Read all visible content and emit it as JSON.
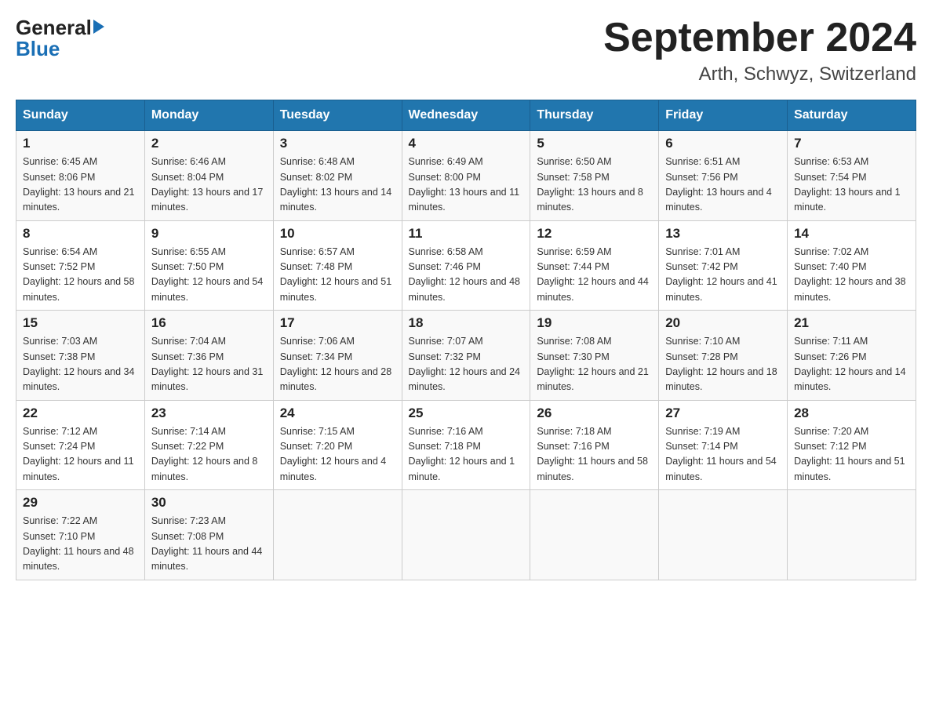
{
  "header": {
    "logo_general": "General",
    "logo_blue": "Blue",
    "month_title": "September 2024",
    "location": "Arth, Schwyz, Switzerland"
  },
  "days_of_week": [
    "Sunday",
    "Monday",
    "Tuesday",
    "Wednesday",
    "Thursday",
    "Friday",
    "Saturday"
  ],
  "weeks": [
    [
      {
        "day": "1",
        "sunrise": "6:45 AM",
        "sunset": "8:06 PM",
        "daylight": "13 hours and 21 minutes."
      },
      {
        "day": "2",
        "sunrise": "6:46 AM",
        "sunset": "8:04 PM",
        "daylight": "13 hours and 17 minutes."
      },
      {
        "day": "3",
        "sunrise": "6:48 AM",
        "sunset": "8:02 PM",
        "daylight": "13 hours and 14 minutes."
      },
      {
        "day": "4",
        "sunrise": "6:49 AM",
        "sunset": "8:00 PM",
        "daylight": "13 hours and 11 minutes."
      },
      {
        "day": "5",
        "sunrise": "6:50 AM",
        "sunset": "7:58 PM",
        "daylight": "13 hours and 8 minutes."
      },
      {
        "day": "6",
        "sunrise": "6:51 AM",
        "sunset": "7:56 PM",
        "daylight": "13 hours and 4 minutes."
      },
      {
        "day": "7",
        "sunrise": "6:53 AM",
        "sunset": "7:54 PM",
        "daylight": "13 hours and 1 minute."
      }
    ],
    [
      {
        "day": "8",
        "sunrise": "6:54 AM",
        "sunset": "7:52 PM",
        "daylight": "12 hours and 58 minutes."
      },
      {
        "day": "9",
        "sunrise": "6:55 AM",
        "sunset": "7:50 PM",
        "daylight": "12 hours and 54 minutes."
      },
      {
        "day": "10",
        "sunrise": "6:57 AM",
        "sunset": "7:48 PM",
        "daylight": "12 hours and 51 minutes."
      },
      {
        "day": "11",
        "sunrise": "6:58 AM",
        "sunset": "7:46 PM",
        "daylight": "12 hours and 48 minutes."
      },
      {
        "day": "12",
        "sunrise": "6:59 AM",
        "sunset": "7:44 PM",
        "daylight": "12 hours and 44 minutes."
      },
      {
        "day": "13",
        "sunrise": "7:01 AM",
        "sunset": "7:42 PM",
        "daylight": "12 hours and 41 minutes."
      },
      {
        "day": "14",
        "sunrise": "7:02 AM",
        "sunset": "7:40 PM",
        "daylight": "12 hours and 38 minutes."
      }
    ],
    [
      {
        "day": "15",
        "sunrise": "7:03 AM",
        "sunset": "7:38 PM",
        "daylight": "12 hours and 34 minutes."
      },
      {
        "day": "16",
        "sunrise": "7:04 AM",
        "sunset": "7:36 PM",
        "daylight": "12 hours and 31 minutes."
      },
      {
        "day": "17",
        "sunrise": "7:06 AM",
        "sunset": "7:34 PM",
        "daylight": "12 hours and 28 minutes."
      },
      {
        "day": "18",
        "sunrise": "7:07 AM",
        "sunset": "7:32 PM",
        "daylight": "12 hours and 24 minutes."
      },
      {
        "day": "19",
        "sunrise": "7:08 AM",
        "sunset": "7:30 PM",
        "daylight": "12 hours and 21 minutes."
      },
      {
        "day": "20",
        "sunrise": "7:10 AM",
        "sunset": "7:28 PM",
        "daylight": "12 hours and 18 minutes."
      },
      {
        "day": "21",
        "sunrise": "7:11 AM",
        "sunset": "7:26 PM",
        "daylight": "12 hours and 14 minutes."
      }
    ],
    [
      {
        "day": "22",
        "sunrise": "7:12 AM",
        "sunset": "7:24 PM",
        "daylight": "12 hours and 11 minutes."
      },
      {
        "day": "23",
        "sunrise": "7:14 AM",
        "sunset": "7:22 PM",
        "daylight": "12 hours and 8 minutes."
      },
      {
        "day": "24",
        "sunrise": "7:15 AM",
        "sunset": "7:20 PM",
        "daylight": "12 hours and 4 minutes."
      },
      {
        "day": "25",
        "sunrise": "7:16 AM",
        "sunset": "7:18 PM",
        "daylight": "12 hours and 1 minute."
      },
      {
        "day": "26",
        "sunrise": "7:18 AM",
        "sunset": "7:16 PM",
        "daylight": "11 hours and 58 minutes."
      },
      {
        "day": "27",
        "sunrise": "7:19 AM",
        "sunset": "7:14 PM",
        "daylight": "11 hours and 54 minutes."
      },
      {
        "day": "28",
        "sunrise": "7:20 AM",
        "sunset": "7:12 PM",
        "daylight": "11 hours and 51 minutes."
      }
    ],
    [
      {
        "day": "29",
        "sunrise": "7:22 AM",
        "sunset": "7:10 PM",
        "daylight": "11 hours and 48 minutes."
      },
      {
        "day": "30",
        "sunrise": "7:23 AM",
        "sunset": "7:08 PM",
        "daylight": "11 hours and 44 minutes."
      },
      null,
      null,
      null,
      null,
      null
    ]
  ],
  "labels": {
    "sunrise": "Sunrise:",
    "sunset": "Sunset:",
    "daylight": "Daylight:"
  }
}
